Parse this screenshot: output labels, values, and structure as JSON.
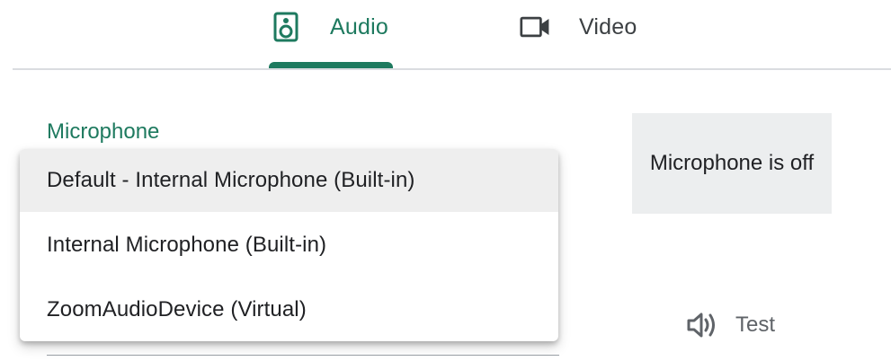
{
  "tabs": [
    {
      "label": "Audio",
      "icon": "speaker-icon",
      "selected": true
    },
    {
      "label": "Video",
      "icon": "video-camera-icon",
      "selected": false
    }
  ],
  "microphone": {
    "section_label": "Microphone",
    "options": [
      "Default - Internal Microphone (Built-in)",
      "Internal Microphone (Built-in)",
      "ZoomAudioDevice (Virtual)"
    ],
    "highlighted_option": "Default - Internal Microphone (Built-in)"
  },
  "status": {
    "text": "Microphone is off"
  },
  "test": {
    "label": "Test",
    "icon": "speaker-volume-icon"
  },
  "colors": {
    "accent": "#1e7a5f",
    "tab_divider": "#dadce0",
    "status_bg": "#eceeef",
    "highlight_bg": "#eeeeee"
  }
}
